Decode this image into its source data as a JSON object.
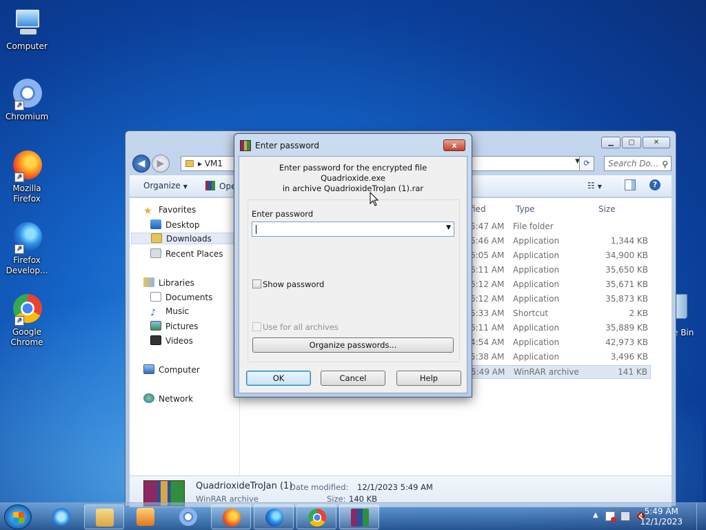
{
  "desktop": {
    "icons": [
      {
        "label": "Computer"
      },
      {
        "label": "Chromium"
      },
      {
        "label": "Mozilla Firefox"
      },
      {
        "label": "Firefox Develop..."
      },
      {
        "label": "Google Chrome"
      }
    ],
    "recycle_bin_label": "e Bin"
  },
  "explorer": {
    "address": "VM1",
    "search_placeholder": "Search Do...",
    "organize": "Organize",
    "open": "Ope",
    "nav": {
      "favorites": "Favorites",
      "desktop": "Desktop",
      "downloads": "Downloads",
      "recent": "Recent Places",
      "libraries": "Libraries",
      "documents": "Documents",
      "music": "Music",
      "pictures": "Pictures",
      "videos": "Videos",
      "computer": "Computer",
      "network": "Network"
    },
    "columns": {
      "modified": "fied",
      "type": "Type",
      "size": "Size"
    },
    "rows": [
      {
        "time": "5:47 AM",
        "type": "File folder",
        "size": ""
      },
      {
        "time": "5:46 AM",
        "type": "Application",
        "size": "1,344 KB"
      },
      {
        "time": "6:05 AM",
        "type": "Application",
        "size": "34,900 KB"
      },
      {
        "time": "6:11 AM",
        "type": "Application",
        "size": "35,650 KB"
      },
      {
        "time": "6:12 AM",
        "type": "Application",
        "size": "35,671 KB"
      },
      {
        "time": "6:12 AM",
        "type": "Application",
        "size": "35,873 KB"
      },
      {
        "time": "5:33 AM",
        "type": "Shortcut",
        "size": "2 KB"
      },
      {
        "time": "6:11 AM",
        "type": "Application",
        "size": "35,889 KB"
      },
      {
        "time": "4:54 AM",
        "type": "Application",
        "size": "42,973 KB"
      },
      {
        "time": "5:38 AM",
        "type": "Application",
        "size": "3,496 KB"
      },
      {
        "time": "5:49 AM",
        "type": "WinRAR archive",
        "size": "141 KB"
      }
    ],
    "details": {
      "name": "QuadrioxideTroJan (1)",
      "modified_label": "Date modified:",
      "modified_value": "12/1/2023 5:49 AM",
      "type": "WinRAR archive",
      "size_label": "Size:",
      "size_value": "140 KB"
    }
  },
  "dialog": {
    "title": "Enter password",
    "line1": "Enter password for the encrypted file",
    "line2": "Quadrioxide.exe",
    "line3": "in archive QuadrioxideTroJan (1).rar",
    "password_label": "Enter password",
    "password_value": "",
    "show_password": "Show password",
    "use_all": "Use for all archives",
    "organize": "Organize passwords...",
    "ok": "OK",
    "cancel": "Cancel",
    "help": "Help",
    "close": "x"
  },
  "taskbar": {
    "time": "5:49 AM",
    "date": "12/1/2023"
  }
}
